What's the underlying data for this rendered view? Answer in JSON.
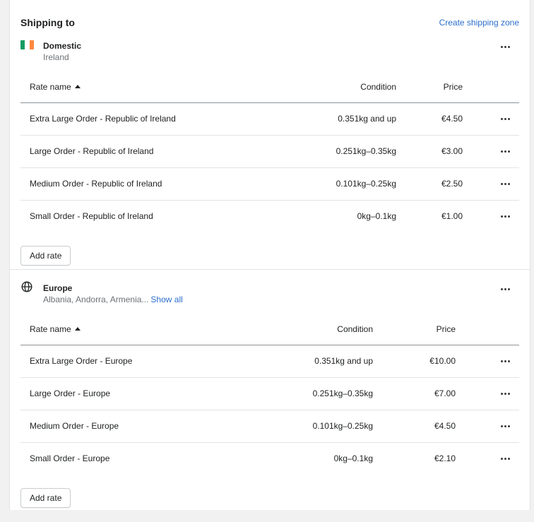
{
  "header": {
    "title": "Shipping to",
    "create_zone_label": "Create shipping zone"
  },
  "columns": {
    "rate_name": "Rate name",
    "condition": "Condition",
    "price": "Price"
  },
  "zones": [
    {
      "name": "Domestic",
      "subtitle": "Ireland",
      "icon": "ireland-flag-icon",
      "flag_colors": [
        "#169b62",
        "#ffffff",
        "#ff883e"
      ],
      "rates": [
        {
          "name": "Extra Large Order - Republic of Ireland",
          "condition": "0.351kg and up",
          "price": "€4.50"
        },
        {
          "name": "Large Order - Republic of Ireland",
          "condition": "0.251kg–0.35kg",
          "price": "€3.00"
        },
        {
          "name": "Medium Order - Republic of Ireland",
          "condition": "0.101kg–0.25kg",
          "price": "€2.50"
        },
        {
          "name": "Small Order - Republic of Ireland",
          "condition": "0kg–0.1kg",
          "price": "€1.00"
        }
      ],
      "add_rate_label": "Add rate"
    },
    {
      "name": "Europe",
      "subtitle": "Albania, Andorra, Armenia...",
      "show_all_label": "Show all",
      "icon": "globe-icon",
      "rates": [
        {
          "name": "Extra Large Order - Europe",
          "condition": "0.351kg and up",
          "price": "€10.00"
        },
        {
          "name": "Large Order - Europe",
          "condition": "0.251kg–0.35kg",
          "price": "€7.00"
        },
        {
          "name": "Medium Order - Europe",
          "condition": "0.101kg–0.25kg",
          "price": "€4.50"
        },
        {
          "name": "Small Order - Europe",
          "condition": "0kg–0.1kg",
          "price": "€2.10"
        }
      ],
      "add_rate_label": "Add rate"
    }
  ],
  "colors": {
    "link": "#2c6ecb",
    "text": "#202223",
    "subdued": "#6d7175"
  }
}
